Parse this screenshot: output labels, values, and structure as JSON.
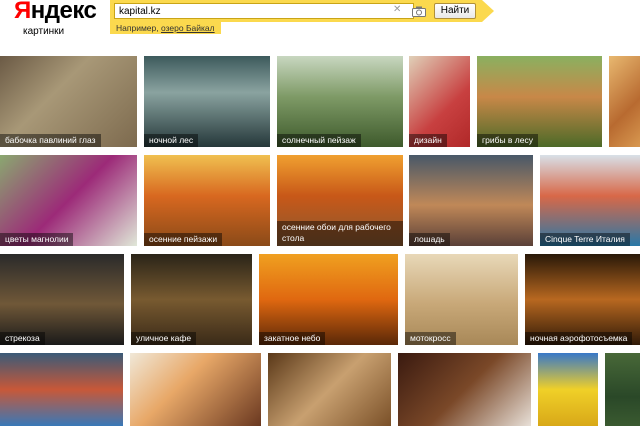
{
  "logo": {
    "first_letter": "Я",
    "rest": "ндекс",
    "subtitle": "картинки"
  },
  "search": {
    "value": "kapital.kz",
    "button_label": "Найти",
    "example_prefix": "Например,",
    "example_link": "озеро Байкал",
    "clear_glyph": "✕"
  },
  "tiles": [
    {
      "caption": "бабочка павлиний глаз",
      "bg": "linear-gradient(135deg,#6b5a45,#a89877 40%,#7d6a4e)"
    },
    {
      "caption": "ночной лес",
      "bg": "linear-gradient(180deg,#3d5a5c,#8aa3a0 40%,#25383a)"
    },
    {
      "caption": "солнечный пейзаж",
      "bg": "linear-gradient(180deg,#c8d7c0,#7e9a66 45%,#3e5a2c)"
    },
    {
      "caption": "дизайн",
      "bg": "linear-gradient(135deg,#e0d0b8,#c84040 60%,#b02828)"
    },
    {
      "caption": "грибы в лесу",
      "bg": "linear-gradient(180deg,#8ab060,#c88848 45%,#4c6a28)"
    },
    {
      "caption": "",
      "bg": "linear-gradient(135deg,#e8b870,#b86a30 60%,#d89850)"
    },
    {
      "caption": "цветы магнолии",
      "bg": "linear-gradient(135deg,#8aa870,#9c2a78 50%,#e0e8d8)"
    },
    {
      "caption": "осенние пейзажи",
      "bg": "linear-gradient(180deg,#f0c050,#d86820 45%,#8a4a18)"
    },
    {
      "caption": "осенние обои для рабочего стола",
      "bg": "linear-gradient(180deg,#f0a030,#c85818 45%,#885830)"
    },
    {
      "caption": "лошадь",
      "bg": "linear-gradient(180deg,#485868,#c08858 55%,#5a4038)"
    },
    {
      "caption": "Cinque Terre Италия",
      "bg": "linear-gradient(180deg,#d8e0e8,#d86848 45%,#2878a8)"
    },
    {
      "caption": "стрекоза",
      "bg": "linear-gradient(180deg,#2a2a2a,#705838 55%,#1a1a1a)"
    },
    {
      "caption": "уличное кафе",
      "bg": "linear-gradient(180deg,#2a2418,#785a30 50%,#3a2a18)"
    },
    {
      "caption": "закатное небо",
      "bg": "linear-gradient(180deg,#f0a020,#e06810 50%,#5a2808)"
    },
    {
      "caption": "мотокросс",
      "bg": "linear-gradient(180deg,#e8d8b8,#c8a878 55%,#a88858)"
    },
    {
      "caption": "ночная аэрофотосъемка",
      "bg": "linear-gradient(180deg,#281808,#b86820 50%,#301a08)"
    },
    {
      "caption": "",
      "bg": "linear-gradient(180deg,#3a5a78,#c85838 50%,#3878b8)"
    },
    {
      "caption": "",
      "bg": "linear-gradient(135deg,#f0e8d8,#e8a868 40%,#6a3820)"
    },
    {
      "caption": "",
      "bg": "linear-gradient(135deg,#5a3818,#c8a070 50%,#7a5028)"
    },
    {
      "caption": "",
      "bg": "linear-gradient(135deg,#3a1a10,#7a4828 50%,#e8e0d8)"
    },
    {
      "caption": "",
      "bg": "linear-gradient(180deg,#3878c8,#f0d028 50%,#d8a818)"
    },
    {
      "caption": "",
      "bg": "linear-gradient(180deg,#486838,#2a4828 60%,#3a5a30)"
    }
  ],
  "colors": {
    "search_bar": "#fbd94e",
    "logo_red": "#ff0000"
  }
}
